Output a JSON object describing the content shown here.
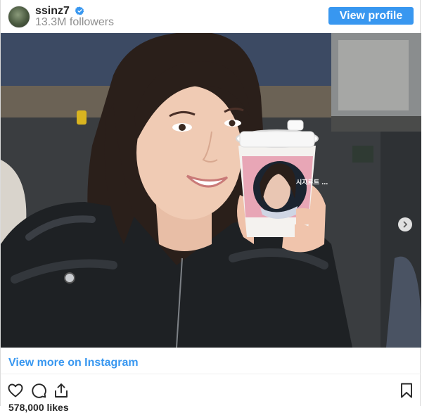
{
  "header": {
    "username": "ssinz7",
    "followers": "13.3M followers",
    "view_profile_label": "View profile",
    "avatar_icon": "profile-avatar",
    "verified_icon": "verified-badge-icon"
  },
  "post": {
    "photo_description_icon": "photo",
    "carousel": {
      "total": 3,
      "active_index": 1,
      "next_icon": "chevron-right-icon"
    },
    "cup_label": "시지르트 …",
    "view_more_label": "View more on Instagram"
  },
  "actions": {
    "like_icon": "heart-icon",
    "comment_icon": "comment-icon",
    "share_icon": "share-icon",
    "save_icon": "bookmark-icon"
  },
  "likes_text": "578,000 likes",
  "colors": {
    "accent": "#3897f0",
    "text": "#262626",
    "muted": "#8e8e8e"
  }
}
